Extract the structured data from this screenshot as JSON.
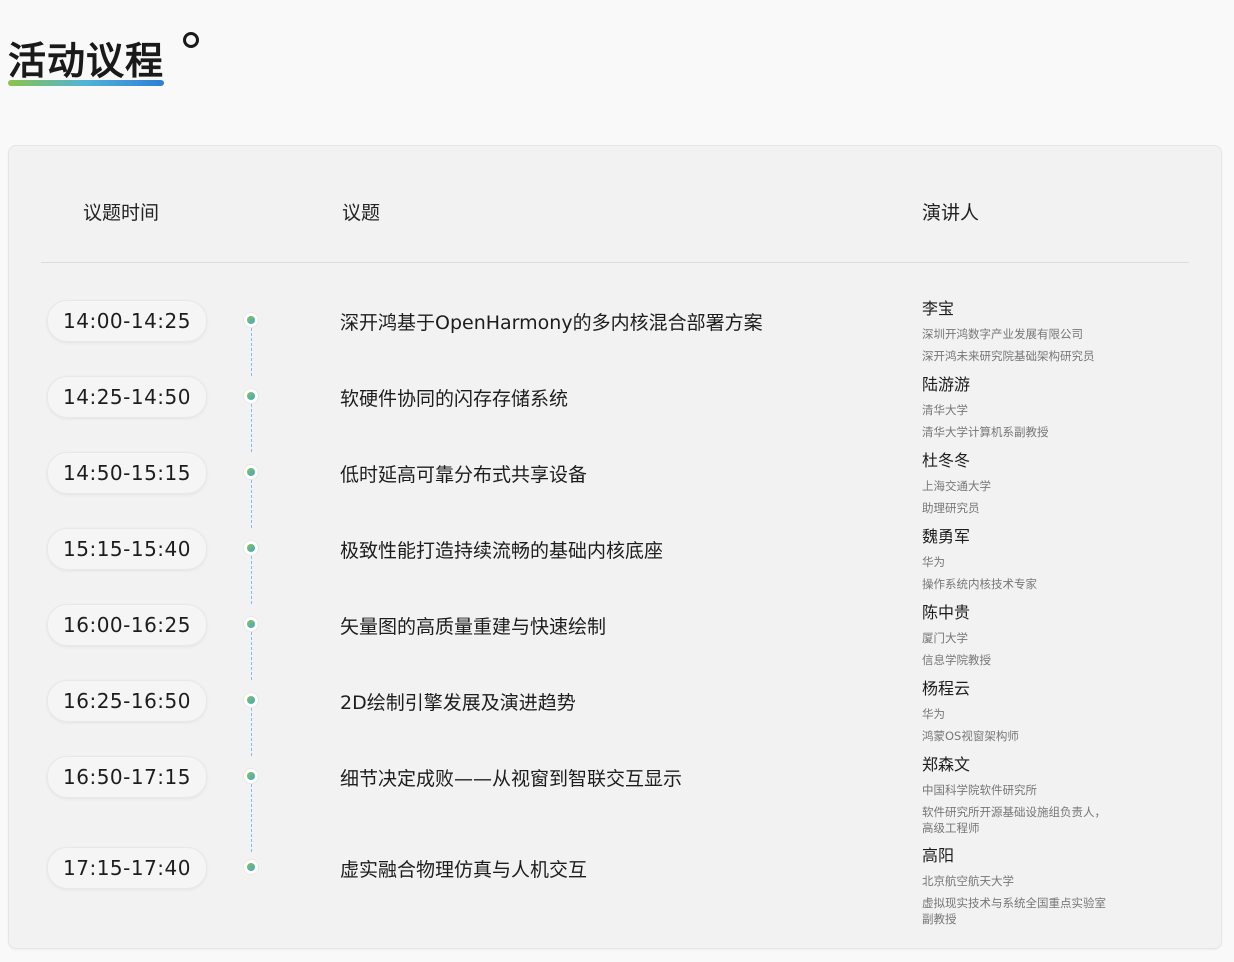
{
  "page": {
    "title": "活动议程"
  },
  "table": {
    "headers": {
      "time": "议题时间",
      "topic": "议题",
      "speaker": "演讲人"
    },
    "rows": [
      {
        "time": "14:00-14:25",
        "topic": "深开鸿基于OpenHarmony的多内核混合部署方案",
        "speaker": "李宝",
        "org": "深圳开鸿数字产业发展有限公司",
        "role": "深开鸿未来研究院基础架构研究员"
      },
      {
        "time": "14:25-14:50",
        "topic": "软硬件协同的闪存存储系统",
        "speaker": "陆游游",
        "org": "清华大学",
        "role": "清华大学计算机系副教授"
      },
      {
        "time": "14:50-15:15",
        "topic": "低时延高可靠分布式共享设备",
        "speaker": "杜冬冬",
        "org": "上海交通大学",
        "role": "助理研究员"
      },
      {
        "time": "15:15-15:40",
        "topic": "极致性能打造持续流畅的基础内核底座",
        "speaker": "魏勇军",
        "org": "华为",
        "role": "操作系统内核技术专家"
      },
      {
        "time": "16:00-16:25",
        "topic": "矢量图的高质量重建与快速绘制",
        "speaker": "陈中贵",
        "org": "厦门大学",
        "role": "信息学院教授"
      },
      {
        "time": "16:25-16:50",
        "topic": "2D绘制引擎发展及演进趋势",
        "speaker": "杨程云",
        "org": "华为",
        "role": "鸿蒙OS视窗架构师"
      },
      {
        "time": "16:50-17:15",
        "topic": "细节决定成败——从视窗到智联交互显示",
        "speaker": "郑森文",
        "org": "中国科学院软件研究所",
        "role": "软件研究所开源基础设施组负责人，",
        "role2": "高级工程师"
      },
      {
        "time": "17:15-17:40",
        "topic": "虚实融合物理仿真与人机交互",
        "speaker": "高阳",
        "org": "北京航空航天大学",
        "role": "虚拟现实技术与系统全国重点实验室",
        "role2": "副教授"
      }
    ]
  },
  "colors": {
    "accent_green": "#8bc34a",
    "accent_blue": "#3aa7d8"
  }
}
